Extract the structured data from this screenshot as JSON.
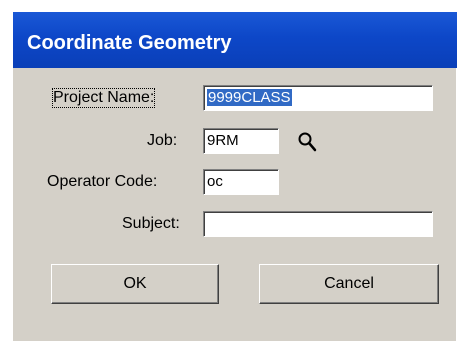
{
  "window": {
    "title": "Coordinate Geometry"
  },
  "form": {
    "project_name": {
      "label": "Project Name:",
      "value": "9999CLASS"
    },
    "job": {
      "label": "Job:",
      "value": "9RM",
      "lookup_icon": "search-icon"
    },
    "operator_code": {
      "label": "Operator Code:",
      "value": "oc"
    },
    "subject": {
      "label": "Subject:",
      "value": ""
    }
  },
  "buttons": {
    "ok": "OK",
    "cancel": "Cancel"
  },
  "colors": {
    "titlebar": "#0d47c8",
    "dialog": "#d4d0c8",
    "selection": "#316ac5"
  }
}
